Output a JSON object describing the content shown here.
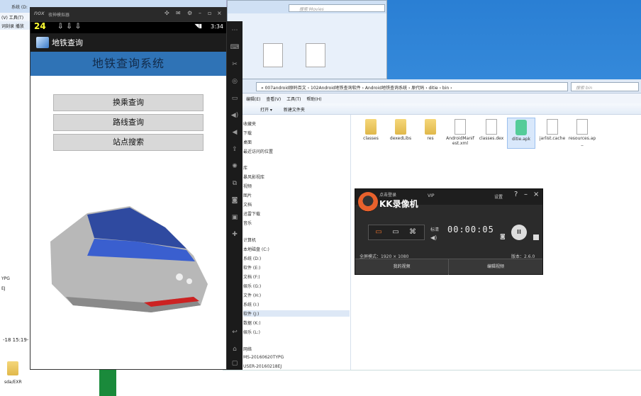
{
  "bg_left": {
    "title": "系统 (D:",
    "menu": "(V)   工具(T)",
    "toolbar": "词刻录  播放",
    "side_text_1": "YPG",
    "side_text_2": "EJ",
    "time": "-18 15:19-",
    "folder_label": "sda/EXR"
  },
  "bg_top": {
    "search_placeholder": "搜索 Movies"
  },
  "explorer": {
    "address": "«  007android原码百文  ›  102Android地铁查询软件  ›  Android地铁查询系统  ›  原代码  ›  ditie  ›  bin  ›",
    "search_placeholder": "搜索 bin",
    "menu": [
      "编辑(E)",
      "查看(V)",
      "工具(T)",
      "帮助(H)"
    ],
    "commands": [
      "打开 ▾",
      "新建文件夹"
    ],
    "nav": [
      {
        "label": "收藏夹",
        "sel": false
      },
      {
        "label": "下载",
        "sel": false
      },
      {
        "label": "桌面",
        "sel": false
      },
      {
        "label": "最近访问的位置",
        "sel": false
      },
      {
        "label": "库",
        "sel": false
      },
      {
        "label": "暴风影视库",
        "sel": false
      },
      {
        "label": "视频",
        "sel": false
      },
      {
        "label": "图片",
        "sel": false
      },
      {
        "label": "文档",
        "sel": false
      },
      {
        "label": "迅雷下载",
        "sel": false
      },
      {
        "label": "音乐",
        "sel": false
      },
      {
        "label": "计算机",
        "sel": false
      },
      {
        "label": "本地磁盘 (C:)",
        "sel": false
      },
      {
        "label": "系统 (D:)",
        "sel": false
      },
      {
        "label": "软件 (E:)",
        "sel": false
      },
      {
        "label": "文档 (F:)",
        "sel": false
      },
      {
        "label": "娱乐 (G:)",
        "sel": false
      },
      {
        "label": "文件 (H:)",
        "sel": false
      },
      {
        "label": "系统 (I:)",
        "sel": false
      },
      {
        "label": "软件 (J:)",
        "sel": true
      },
      {
        "label": "数据 (K:)",
        "sel": false
      },
      {
        "label": "娱乐 (L:)",
        "sel": false
      },
      {
        "label": "网络",
        "sel": false
      },
      {
        "label": "MS-20160620TYPG",
        "sel": false
      },
      {
        "label": "USER-20160218EJ",
        "sel": false
      }
    ],
    "files": [
      {
        "name": "classes",
        "kind": "folder"
      },
      {
        "name": "dexedLibs",
        "kind": "folder"
      },
      {
        "name": "res",
        "kind": "folder"
      },
      {
        "name": "AndroidManifest.xml",
        "kind": "doc"
      },
      {
        "name": "classes.dex",
        "kind": "doc"
      },
      {
        "name": "ditie.apk",
        "kind": "apk"
      },
      {
        "name": "jarlist.cache",
        "kind": "doc"
      },
      {
        "name": "resources.ap_",
        "kind": "doc"
      }
    ]
  },
  "kk": {
    "login": "点击登录",
    "vip": "VIP",
    "settings": "设置",
    "brand": "KK录像机",
    "clock": "00:00:05",
    "audio_label": "标清",
    "fullscreen": "全屏模式：1920 × 1080",
    "version": "版本：2.6.0",
    "foot_left": "我的视频",
    "foot_right": "编辑视频"
  },
  "emulator": {
    "window_title": "夜神模拟器",
    "logo_text": "nox",
    "status_num": "24",
    "notifications": "⇩⇩⇩",
    "time": "3:34",
    "app_label": "地铁查询",
    "banner": "地铁查询系统",
    "buttons": [
      "换乘查询",
      "路线查询",
      "站点搜索"
    ]
  }
}
